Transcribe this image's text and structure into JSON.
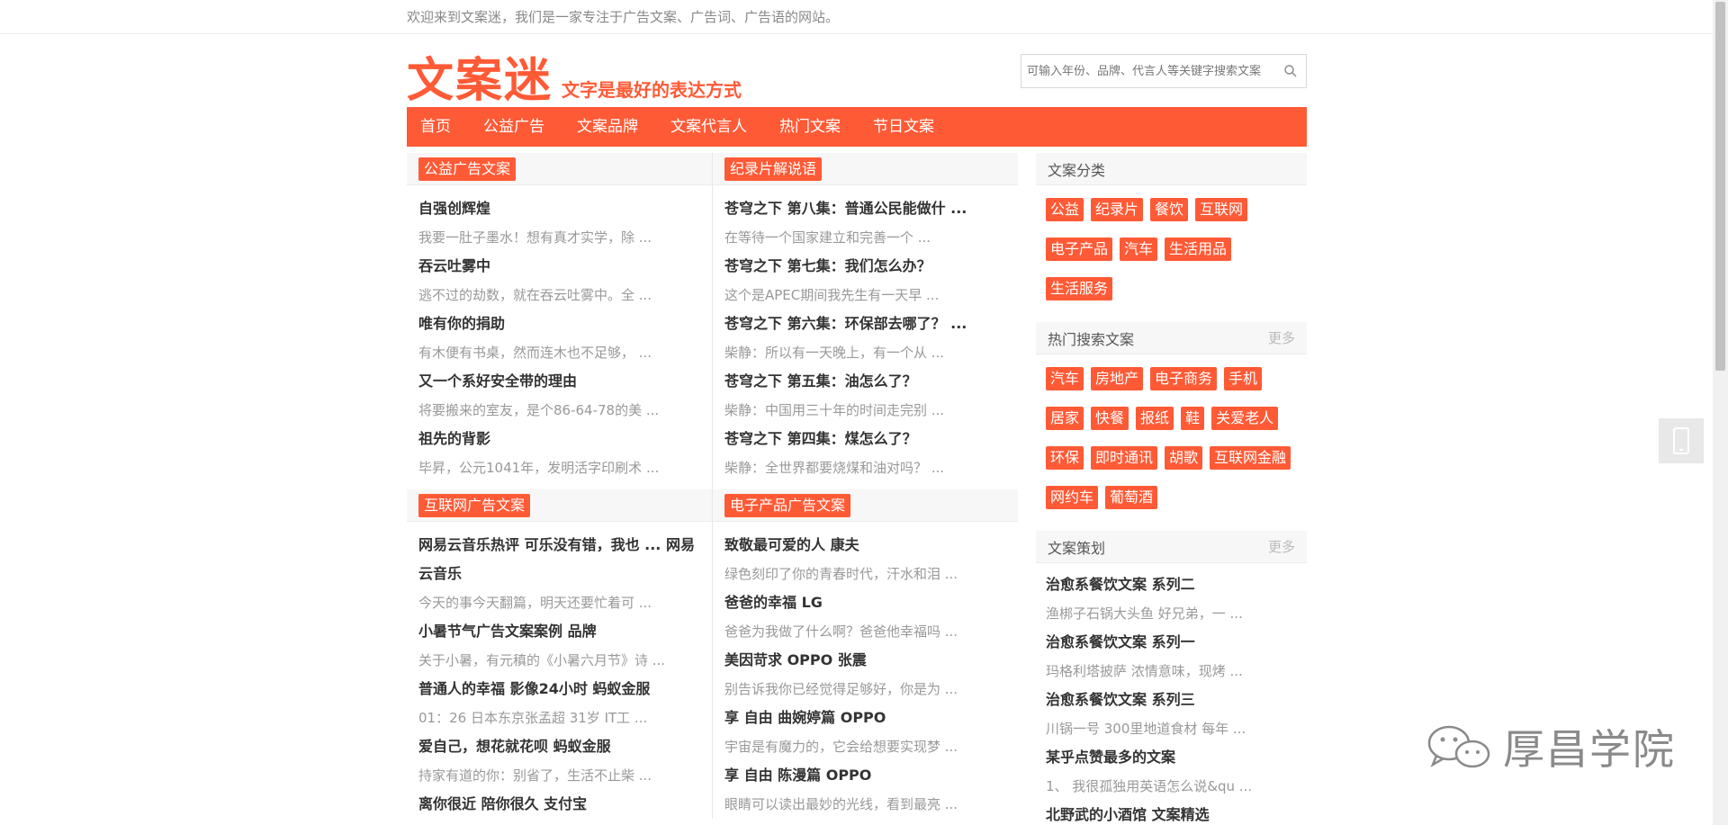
{
  "topbar": {
    "welcome": "欢迎来到文案迷，我们是一家专注于广告文案、广告词、广告语的网站。"
  },
  "header": {
    "logo_main": "文案迷",
    "logo_sub": "文字是最好的表达方式",
    "search_placeholder": "可输入年份、品牌、代言人等关键字搜索文案"
  },
  "nav": [
    "首页",
    "公益广告",
    "文案品牌",
    "文案代言人",
    "热门文案",
    "节日文案"
  ],
  "sections": {
    "gongyi": {
      "tag": "公益广告文案",
      "items": [
        {
          "title": "自强创辉煌",
          "desc": "我要一肚子墨水！想有真才实学，除 ..."
        },
        {
          "title": "吞云吐雾中",
          "desc": "逃不过的劫数，就在吞云吐雾中。全 ..."
        },
        {
          "title": "唯有你的捐助",
          "desc": "有木便有书桌，然而连木也不足够， ..."
        },
        {
          "title": "又一个系好安全带的理由",
          "desc": "将要搬来的室友，是个86-64-78的美 ..."
        },
        {
          "title": "祖先的背影",
          "desc": "毕昇，公元1041年，发明活字印刷术 ..."
        }
      ]
    },
    "jilupian": {
      "tag": "纪录片解说语",
      "items": [
        {
          "title": "苍穹之下 第八集：普通公民能做什 ...",
          "desc": "在等待一个国家建立和完善一个 ..."
        },
        {
          "title": "苍穹之下 第七集：我们怎么办？",
          "desc": "这个是APEC期间我先生有一天早 ..."
        },
        {
          "title": "苍穹之下 第六集：环保部去哪了？ ...",
          "desc": "柴静：所以有一天晚上，有一个从 ..."
        },
        {
          "title": "苍穹之下 第五集：油怎么了？",
          "desc": "柴静：中国用三十年的时间走完别 ..."
        },
        {
          "title": "苍穹之下 第四集：煤怎么了？",
          "desc": "柴静：全世界都要烧煤和油对吗？ ..."
        }
      ]
    },
    "hulianwang": {
      "tag": "互联网广告文案",
      "items": [
        {
          "title": "网易云音乐热评 可乐没有错，我也 ... 网易云音乐",
          "desc": "今天的事今天翻篇，明天还要忙着可 ..."
        },
        {
          "title": "小暑节气广告文案案例 品牌",
          "desc": "关于小暑，有元稹的《小暑六月节》诗 ..."
        },
        {
          "title": "普通人的幸福 影像24小时 蚂蚁金服",
          "desc": "01：26 日本东京张孟超 31岁 IT工 ..."
        },
        {
          "title": "爱自己，想花就花呗 蚂蚁金服",
          "desc": "持家有道的你：别省了，生活不止柴 ..."
        },
        {
          "title": "离你很近 陪你很久 支付宝",
          "desc": ""
        }
      ]
    },
    "dianzi": {
      "tag": "电子产品广告文案",
      "items": [
        {
          "title": "致敬最可爱的人 康夫",
          "desc": "绿色刻印了你的青春时代，汗水和泪 ..."
        },
        {
          "title": "爸爸的幸福 LG",
          "desc": "爸爸为我做了什么啊？爸爸他幸福吗 ..."
        },
        {
          "title": "美因苛求 OPPO 张震",
          "desc": "别告诉我你已经觉得足够好，你是为 ..."
        },
        {
          "title": "享 自由 曲婉婷篇 OPPO",
          "desc": "宇宙是有魔力的，它会给想要实现梦 ..."
        },
        {
          "title": "享 自由 陈漫篇 OPPO",
          "desc": "眼睛可以读出最妙的光线，看到最亮 ..."
        }
      ]
    }
  },
  "sidebar": {
    "categories": {
      "title": "文案分类",
      "tags": [
        "公益",
        "纪录片",
        "餐饮",
        "互联网",
        "电子产品",
        "汽车",
        "生活用品",
        "生活服务"
      ]
    },
    "hot_search": {
      "title": "热门搜索文案",
      "more": "更多",
      "tags": [
        "汽车",
        "房地产",
        "电子商务",
        "手机",
        "居家",
        "快餐",
        "报纸",
        "鞋",
        "关爱老人",
        "环保",
        "即时通讯",
        "胡歌",
        "互联网金融",
        "网约车",
        "葡萄酒"
      ]
    },
    "planning": {
      "title": "文案策划",
      "more": "更多",
      "items": [
        {
          "title": "治愈系餐饮文案 系列二",
          "desc": "渔梆子石锅大头鱼 好兄弟，一 ..."
        },
        {
          "title": "治愈系餐饮文案 系列一",
          "desc": "玛格利塔披萨 浓情意味，现烤 ..."
        },
        {
          "title": "治愈系餐饮文案 系列三",
          "desc": "川锅一号 300里地道食材 每年 ..."
        },
        {
          "title": "某乎点赞最多的文案",
          "desc": "1、 我很孤独用英语怎么说&qu ..."
        },
        {
          "title": "北野武的小酒馆 文案精选",
          "desc": ""
        }
      ]
    }
  },
  "watermark": {
    "text": "厚昌学院"
  },
  "colors": {
    "accent": "#ff5a36"
  }
}
